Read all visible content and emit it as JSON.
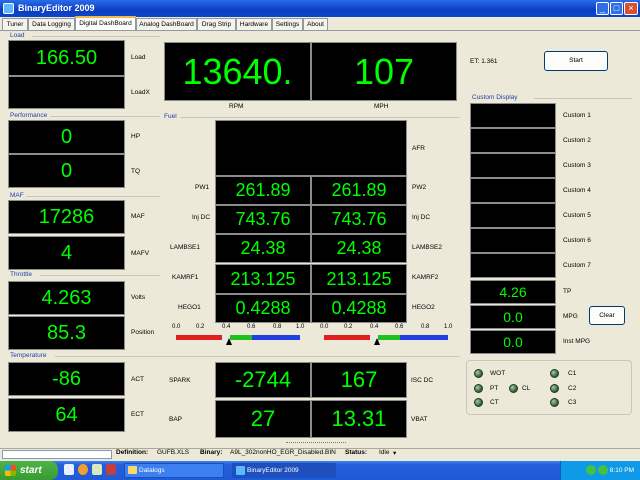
{
  "window": {
    "title": "BinaryEditor 2009"
  },
  "tabs": [
    "Tuner",
    "Data Logging",
    "Digital DashBoard",
    "Analog DashBoard",
    "Drag Strip",
    "Hardware",
    "Settings",
    "About"
  ],
  "groups": {
    "load": "Load",
    "performance": "Performance",
    "maf": "MAF",
    "throttle": "Throttle",
    "temperature": "Temperature",
    "fuel": "Fuel",
    "custom": "Custom Display"
  },
  "gauges": {
    "load": {
      "value": "166.50",
      "label": "Load"
    },
    "loadx": {
      "value": "",
      "label": "LoadX"
    },
    "rpm": {
      "value": "13640.",
      "label": "RPM"
    },
    "mph": {
      "value": "107",
      "label": "MPH"
    },
    "hp": {
      "value": "0",
      "label": "HP"
    },
    "tq": {
      "value": "0",
      "label": "TQ"
    },
    "maf": {
      "value": "17286",
      "label": "MAF"
    },
    "mafv": {
      "value": "4",
      "label": "MAFV"
    },
    "volts": {
      "value": "4.263",
      "label": "Volts"
    },
    "position": {
      "value": "85.3",
      "label": "Position"
    },
    "act": {
      "value": "-86",
      "label": "ACT"
    },
    "ect": {
      "value": "64",
      "label": "ECT"
    },
    "afr": {
      "value": "",
      "label": "AFR"
    },
    "pw1": {
      "value": "261.89",
      "label": "PW1"
    },
    "pw2": {
      "value": "261.89",
      "label": "PW2"
    },
    "injdc1": {
      "value": "743.76",
      "label": "Inj DC"
    },
    "injdc2": {
      "value": "743.76",
      "label": "Inj DC"
    },
    "lambse1": {
      "value": "24.38",
      "label": "LAMBSE1"
    },
    "lambse2": {
      "value": "24.38",
      "label": "LAMBSE2"
    },
    "kamrf1": {
      "value": "213.125",
      "label": "KAMRF1"
    },
    "kamrf2": {
      "value": "213.125",
      "label": "KAMRF2"
    },
    "hego1": {
      "value": "0.4288",
      "label": "HEGO1"
    },
    "hego2": {
      "value": "0.4288",
      "label": "HEGO2"
    },
    "spark": {
      "value": "-2744",
      "label": "SPARK"
    },
    "iscdc": {
      "value": "167",
      "label": "ISC DC"
    },
    "bap": {
      "value": "27",
      "label": "BAP"
    },
    "vbat": {
      "value": "13.31",
      "label": "VBAT"
    }
  },
  "hego_scale": {
    "ticks": [
      "0.0",
      "0.2",
      "0.4",
      "0.6",
      "0.8",
      "1.0"
    ],
    "marker1": 0.4288,
    "marker2": 0.4288
  },
  "et": "ET: 1.361",
  "start_button": "Start",
  "custom": [
    {
      "label": "Custom 1",
      "value": ""
    },
    {
      "label": "Custom 2",
      "value": ""
    },
    {
      "label": "Custom 3",
      "value": ""
    },
    {
      "label": "Custom 4",
      "value": ""
    },
    {
      "label": "Custom 5",
      "value": ""
    },
    {
      "label": "Custom 6",
      "value": ""
    },
    {
      "label": "Custom 7",
      "value": ""
    },
    {
      "label": "TP",
      "value": "4.26"
    },
    {
      "label": "MPG",
      "value": "0.0"
    },
    {
      "label": "Inst MPG",
      "value": "0.0"
    }
  ],
  "clear_button": "Clear",
  "indicators": {
    "wot": "WOT",
    "pt": "PT",
    "cl": "CL",
    "ct": "CT",
    "c1": "C1",
    "c2": "C2",
    "c3": "C3"
  },
  "status": {
    "definition_label": "Definition:",
    "definition_value": "GUFB.XLS",
    "binary_label": "Binary:",
    "binary_value": "A9L_302nonHO_EGR_Disabled.BIN",
    "status_label": "Status:",
    "status_value": "Idle"
  },
  "taskbar": {
    "start": "start",
    "items": [
      "Datalogs",
      "BinaryEditor 2009"
    ],
    "clock": "8:10 PM"
  },
  "colors": {
    "digit": "#00ff00",
    "panel": "#000000"
  }
}
